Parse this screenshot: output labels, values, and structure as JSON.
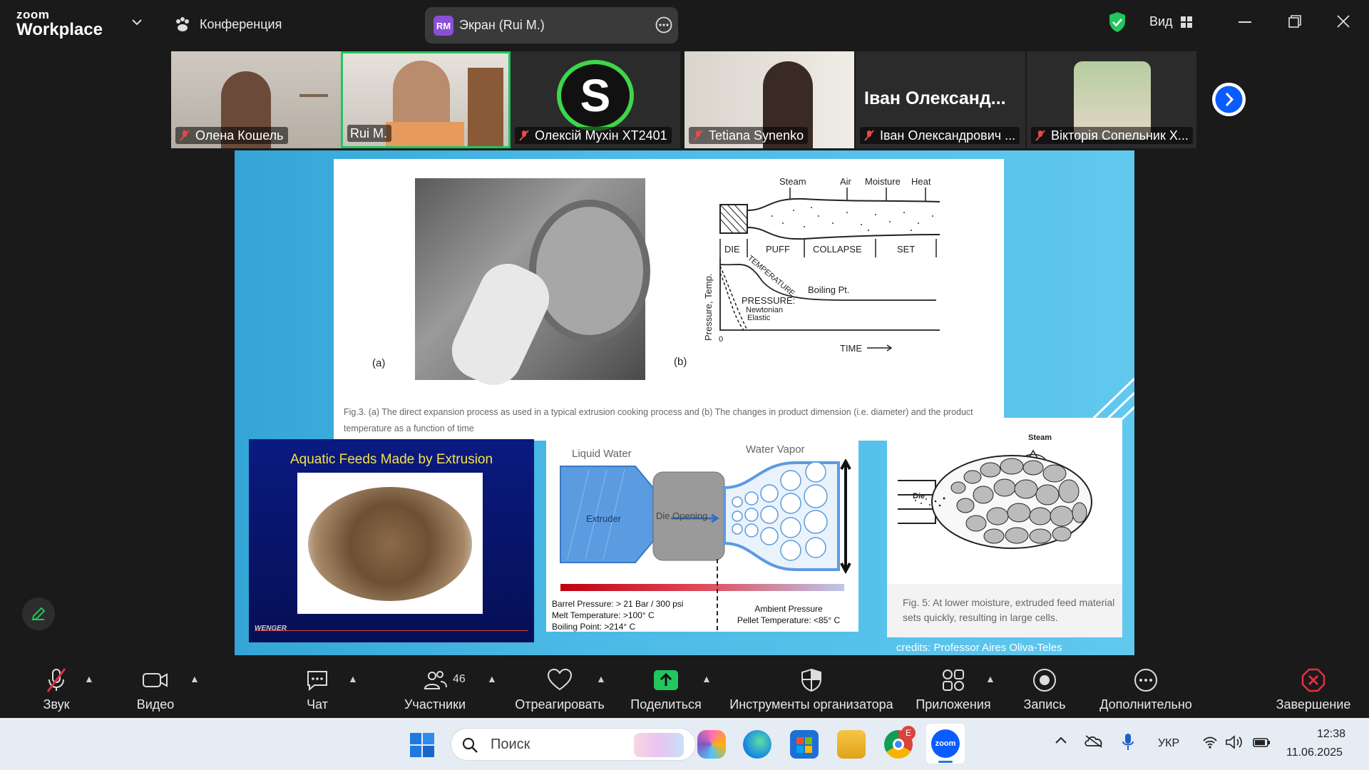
{
  "app": {
    "logo_top": "zoom",
    "logo_bottom": "Workplace",
    "conference_label": "Конференция",
    "share_badge": "RM",
    "share_label": "Экран (Rui M.)",
    "view_label": "Вид"
  },
  "participants": [
    {
      "name": "Олена Кошель",
      "muted": true
    },
    {
      "name": "Rui M.",
      "muted": false,
      "active": true
    },
    {
      "name": "Олексій Мухін ХТ2401",
      "muted": true
    },
    {
      "name": "Tetiana Synenko",
      "muted": true
    },
    {
      "name": "Іван Олександрович ...",
      "muted": true,
      "overlay": "Іван  Олександ..."
    },
    {
      "name": "Вікторія Сопельник Х...",
      "muted": true
    }
  ],
  "slide": {
    "fig_a_label": "(a)",
    "fig_b_label": "(b)",
    "diagram": {
      "steam": "Steam",
      "air": "Air",
      "moisture": "Moisture",
      "heat": "Heat",
      "die": "DIE",
      "puff": "PUFF",
      "collapse": "COLLAPSE",
      "set": "SET",
      "temperature": "TEMPERATURE",
      "boiling": "Boiling Pt.",
      "pressure": "PRESSURE:",
      "newtonian": "Newtonian",
      "elastic": "Elastic",
      "yaxis": "Pressure, Temp.",
      "xaxis": "TIME",
      "origin": "0"
    },
    "caption": "Fig.3. (a) The direct expansion process as used in a typical extrusion cooking process and (b) The changes in product dimension (i.e. diameter) and the product temperature as a function of time",
    "aquatic_title": "Aquatic Feeds Made by Extrusion",
    "wenger": "WENGER",
    "phase": {
      "liquid": "Liquid Water",
      "vapor": "Water Vapor",
      "extruder": "Extruder",
      "die_opening": "Die Opening",
      "barrel_pressure": "Barrel Pressure:  > 21 Bar / 300 psi",
      "melt_temp": "Melt Temperature: >100° C",
      "boiling_point": "Boiling Point:  >214° C",
      "ambient": "Ambient Pressure",
      "pellet_temp": "Pellet Temperature: <85° C"
    },
    "fig5": {
      "steam": "Steam",
      "die": "Die",
      "caption": "Fig. 5: At lower moisture, extruded feed material sets quickly, resulting in large cells."
    },
    "credits": "credits: Professor Aires Oliva-Teles"
  },
  "toolbar": {
    "audio": "Звук",
    "video": "Видео",
    "chat": "Чат",
    "participants": "Участники",
    "participants_count": "46",
    "react": "Отреагировать",
    "share": "Поделиться",
    "host_tools": "Инструменты организатора",
    "apps": "Приложения",
    "record": "Запись",
    "more": "Дополнительно",
    "end": "Завершение"
  },
  "taskbar": {
    "search_placeholder": "Поиск",
    "language": "УКР",
    "time": "12:38",
    "date": "11.06.2025",
    "chrome_badge": "E"
  },
  "colors": {
    "active_green": "#22c55e",
    "end_red": "#e02f44",
    "share_green": "#23c55e",
    "slide_blue": "#4bbae6"
  }
}
